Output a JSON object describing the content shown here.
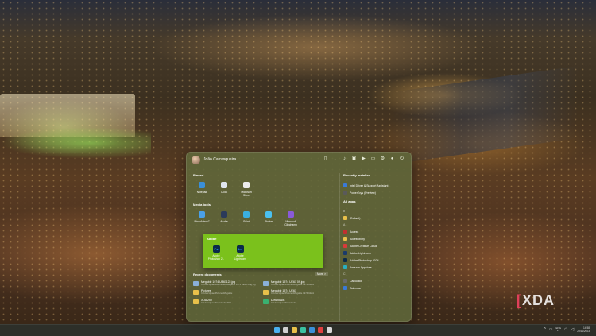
{
  "start_menu": {
    "username": "João Carrasqueira",
    "header_icons": [
      "document-icon",
      "download-icon",
      "music-icon",
      "image-icon",
      "video-icon",
      "folder-icon",
      "settings-icon",
      "user-icon",
      "power-icon"
    ],
    "pinned_title": "Pinned",
    "pinned": [
      {
        "label": "Notepad",
        "color": "#3a8fd8"
      },
      {
        "label": "Clock",
        "color": "#e0e6ef"
      },
      {
        "label": "Microsoft Store",
        "color": "#ececec"
      }
    ],
    "media_title": "Media tools",
    "media": [
      {
        "label": "PhotoMirror7",
        "color": "#4aa0e8"
      },
      {
        "label": "Adobe",
        "color": "#2b3a5a"
      },
      {
        "label": "Paint",
        "color": "#3ab0e0"
      },
      {
        "label": "Photos",
        "color": "#4ac0f0"
      },
      {
        "label": "Microsoft Clipchamp",
        "color": "#8a5ad8"
      }
    ],
    "folder": {
      "title": "Adobe",
      "apps": [
        {
          "label": "Adobe Photoshop 2...",
          "letters": "Ps",
          "color": "#0b2a4a",
          "text": "#31a8ff"
        },
        {
          "label": "Adobe Lightroom",
          "letters": "Lr",
          "color": "#0b2a4a",
          "text": "#31a8ff"
        }
      ]
    },
    "recent_title": "Recent documents",
    "more_label": "More >",
    "recent_docs": [
      {
        "name": "Megable 1974 UE61122.jpg",
        "path": "C:\\Users\\joao\\Downloads\\Megable 1974 UE61 Flag.jpg",
        "color": "#8ab0d8"
      },
      {
        "name": "Megable 1974 UE61 09.jpg",
        "path": "C:\\Users\\joao\\Pictures\\Megable 1974 UE61",
        "color": "#8ab0d8"
      },
      {
        "name": "Pictures",
        "path": "C:\\Users\\joao\\Pictures\\Megable",
        "color": "#e8c04a"
      },
      {
        "name": "Megable 1974 UE61",
        "path": "C:\\Users\\joao\\Pictures\\Megable 1974 UE61",
        "color": "#e8c04a"
      },
      {
        "name": "XDA 250",
        "path": "C:\\Users\\joao\\Downloads\\XDA",
        "color": "#e8c04a"
      },
      {
        "name": "Downloads",
        "path": "C:\\Users\\joao\\Downloads",
        "color": "#3ab070"
      }
    ],
    "recently_installed_title": "Recently installed",
    "recently_installed": [
      {
        "label": "Intel Driver & Support Assistant",
        "color": "#3a7ad8"
      },
      {
        "label": "PowerToys (Preview)",
        "color": "#5a5a5a"
      }
    ],
    "all_apps_title": "All apps",
    "all_apps": [
      {
        "type": "letter",
        "label": "#"
      },
      {
        "type": "app",
        "label": "(Default)",
        "color": "#e8c04a"
      },
      {
        "type": "letter",
        "label": "A"
      },
      {
        "type": "app",
        "label": "Access",
        "color": "#c03030"
      },
      {
        "type": "app",
        "label": "Accessibility",
        "color": "#e8c04a"
      },
      {
        "type": "app",
        "label": "Adobe Creative Cloud",
        "color": "#d83a3a"
      },
      {
        "type": "app",
        "label": "Adobe Lightroom",
        "color": "#1a3a6a"
      },
      {
        "type": "app",
        "label": "Adobe Photoshop 2024",
        "color": "#0b2a4a"
      },
      {
        "type": "app",
        "label": "Amazon Appstore",
        "color": "#2ab0c0"
      },
      {
        "type": "letter",
        "label": "C"
      },
      {
        "type": "app",
        "label": "Calculator",
        "color": "#6a6a6a"
      },
      {
        "type": "app",
        "label": "Calendar",
        "color": "#3a7ad8"
      }
    ]
  },
  "watermark": "XDA",
  "taskbar": {
    "apps": [
      {
        "name": "start-icon",
        "color": "#4ab0f0"
      },
      {
        "name": "search-icon",
        "color": "#d0d0d0"
      },
      {
        "name": "file-explorer-icon",
        "color": "#e8c04a"
      },
      {
        "name": "edge-icon",
        "color": "#3ac0a0"
      },
      {
        "name": "store-icon",
        "color": "#3a8fd8"
      },
      {
        "name": "vivaldi-icon",
        "color": "#e04040"
      },
      {
        "name": "chrome-icon",
        "color": "#d8d8d8"
      }
    ],
    "lang_top": "ENG",
    "lang_bottom": "PT",
    "time": "14:58",
    "date": "29/11/2023"
  }
}
